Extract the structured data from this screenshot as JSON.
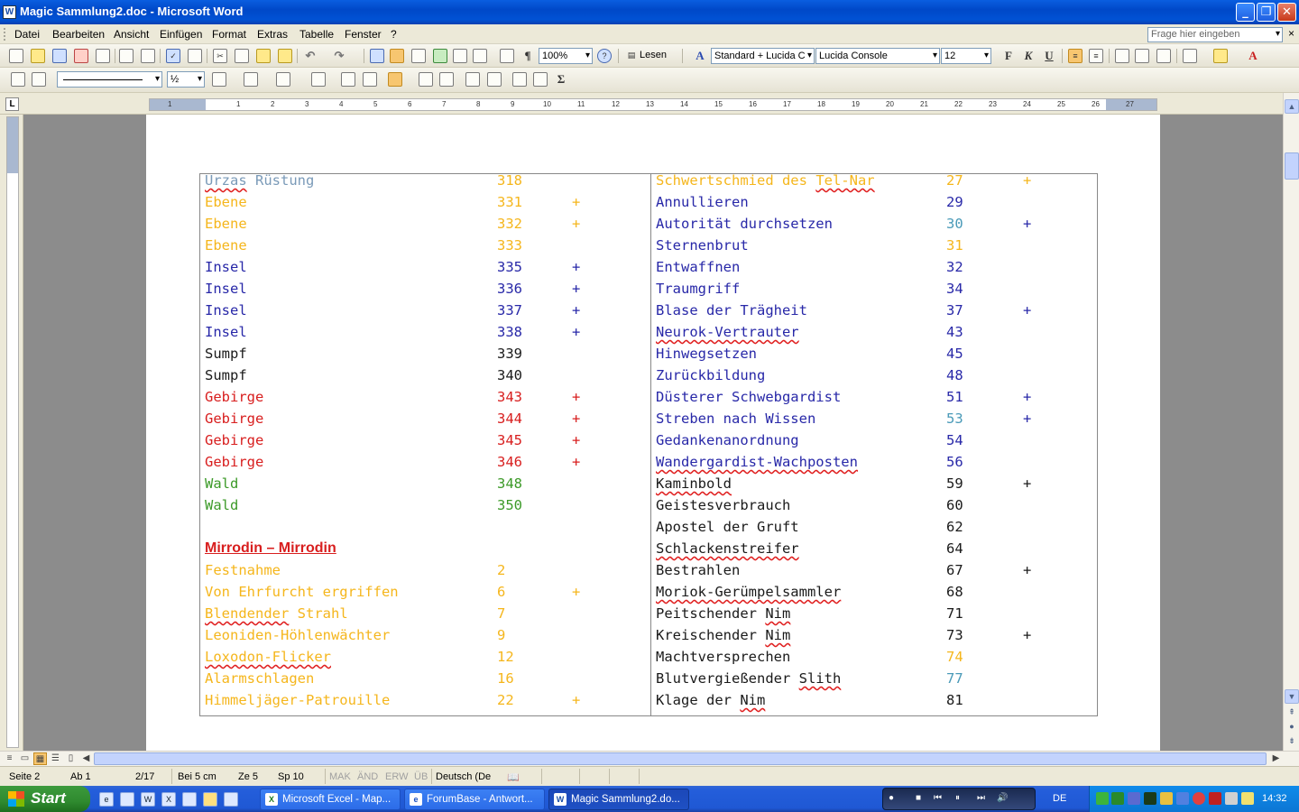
{
  "window": {
    "title": "Magic Sammlung2.doc - Microsoft Word",
    "app_icon": "W",
    "minimize": "_",
    "restore": "❐",
    "close": "✕"
  },
  "menu": {
    "items": [
      "Datei",
      "Bearbeiten",
      "Ansicht",
      "Einfügen",
      "Format",
      "Extras",
      "Tabelle",
      "Fenster",
      "?"
    ],
    "ask_placeholder": "Frage hier eingeben"
  },
  "toolbar": {
    "zoom": "100%",
    "read_button": "Lesen",
    "style": "Standard + Lucida C",
    "font": "Lucida Console",
    "size": "12",
    "bold": "F",
    "italic": "K",
    "underline": "U",
    "line_weight": "½",
    "paragraph_mark": "¶",
    "sum": "Σ"
  },
  "ruler": {
    "corner": "L",
    "numbers": [
      "1",
      "1",
      "2",
      "3",
      "4",
      "5",
      "6",
      "7",
      "8",
      "9",
      "10",
      "11",
      "12",
      "13",
      "14",
      "15",
      "16",
      "17",
      "18",
      "19",
      "20",
      "21",
      "22",
      "23",
      "24",
      "25",
      "26",
      "27"
    ]
  },
  "colors": {
    "yellow": "#f5b61c",
    "blue": "#2828a8",
    "black": "#1a1a1a",
    "red": "#d81e1e",
    "green": "#3c9a28",
    "grayblue": "#7a9ab8",
    "teal": "#4a9ab8"
  },
  "document": {
    "left_rows": [
      {
        "name": "Urzas Rüstung",
        "num": "318",
        "mark": "",
        "color": "grayblue",
        "spell": "Urzas",
        "num_color": "yellow"
      },
      {
        "name": "Ebene",
        "num": "331",
        "mark": "+",
        "color": "yellow"
      },
      {
        "name": "Ebene",
        "num": "332",
        "mark": "+",
        "color": "yellow"
      },
      {
        "name": "Ebene",
        "num": "333",
        "mark": "",
        "color": "yellow"
      },
      {
        "name": "Insel",
        "num": "335",
        "mark": "+",
        "color": "blue"
      },
      {
        "name": "Insel",
        "num": "336",
        "mark": "+",
        "color": "blue"
      },
      {
        "name": "Insel",
        "num": "337",
        "mark": "+",
        "color": "blue"
      },
      {
        "name": "Insel",
        "num": "338",
        "mark": "+",
        "color": "blue"
      },
      {
        "name": "Sumpf",
        "num": "339",
        "mark": "",
        "color": "black"
      },
      {
        "name": "Sumpf",
        "num": "340",
        "mark": "",
        "color": "black"
      },
      {
        "name": "Gebirge",
        "num": "343",
        "mark": "+",
        "color": "red"
      },
      {
        "name": "Gebirge",
        "num": "344",
        "mark": "+",
        "color": "red"
      },
      {
        "name": "Gebirge",
        "num": "345",
        "mark": "+",
        "color": "red"
      },
      {
        "name": "Gebirge",
        "num": "346",
        "mark": "+",
        "color": "red"
      },
      {
        "name": "Wald",
        "num": "348",
        "mark": "",
        "color": "green"
      },
      {
        "name": "Wald",
        "num": "350",
        "mark": "",
        "color": "green"
      },
      {
        "name": "",
        "num": "",
        "mark": "",
        "color": "black"
      },
      {
        "name": "Mirrodin – Mirrodin",
        "num": "",
        "mark": "",
        "color": "red",
        "heading": true
      },
      {
        "name": "Festnahme",
        "num": "2",
        "mark": "",
        "color": "yellow"
      },
      {
        "name": "Von Ehrfurcht ergriffen",
        "num": "6",
        "mark": "+",
        "color": "yellow"
      },
      {
        "name": "Blendender Strahl",
        "num": "7",
        "mark": "",
        "color": "yellow",
        "spell": "Blendender"
      },
      {
        "name": "Leoniden-Höhlenwächter",
        "num": "9",
        "mark": "",
        "color": "yellow"
      },
      {
        "name": "Loxodon-Flicker",
        "num": "12",
        "mark": "",
        "color": "yellow",
        "spell": "Loxodon-Flicker"
      },
      {
        "name": "Alarmschlagen",
        "num": "16",
        "mark": "",
        "color": "yellow"
      },
      {
        "name": "Himmeljäger-Patrouille",
        "num": "22",
        "mark": "+",
        "color": "yellow"
      }
    ],
    "right_rows": [
      {
        "name": "Schwertschmied des Tel-Nar",
        "num": "27",
        "mark": "+",
        "color": "yellow",
        "spell": "Tel-Nar"
      },
      {
        "name": "Annullieren",
        "num": "29",
        "mark": "",
        "color": "blue"
      },
      {
        "name": "Autorität durchsetzen",
        "num": "30",
        "mark": "+",
        "color": "blue",
        "num_color": "teal"
      },
      {
        "name": "Sternenbrut",
        "num": "31",
        "mark": "",
        "color": "blue",
        "num_color": "yellow"
      },
      {
        "name": "Entwaffnen",
        "num": "32",
        "mark": "",
        "color": "blue"
      },
      {
        "name": "Traumgriff",
        "num": "34",
        "mark": "",
        "color": "blue"
      },
      {
        "name": "Blase der Trägheit",
        "num": "37",
        "mark": "+",
        "color": "blue"
      },
      {
        "name": "Neurok-Vertrauter",
        "num": "43",
        "mark": "",
        "color": "blue",
        "spell": "Neurok-Vertrauter"
      },
      {
        "name": "Hinwegsetzen",
        "num": "45",
        "mark": "",
        "color": "blue"
      },
      {
        "name": "Zurückbildung",
        "num": "48",
        "mark": "",
        "color": "blue"
      },
      {
        "name": "Düsterer Schwebgardist",
        "num": "51",
        "mark": "+",
        "color": "blue"
      },
      {
        "name": "Streben nach Wissen",
        "num": "53",
        "mark": "+",
        "color": "blue",
        "num_color": "teal"
      },
      {
        "name": "Gedankenanordnung",
        "num": "54",
        "mark": "",
        "color": "blue"
      },
      {
        "name": "Wandergardist-Wachposten",
        "num": "56",
        "mark": "",
        "color": "blue",
        "spell": "Wandergardist-Wachposten"
      },
      {
        "name": "Kaminbold",
        "num": "59",
        "mark": "+",
        "color": "black",
        "spell": "Kaminbold"
      },
      {
        "name": "Geistesverbrauch",
        "num": "60",
        "mark": "",
        "color": "black"
      },
      {
        "name": "Apostel der Gruft",
        "num": "62",
        "mark": "",
        "color": "black"
      },
      {
        "name": "Schlackenstreifer",
        "num": "64",
        "mark": "",
        "color": "black",
        "spell": "Schlackenstreifer"
      },
      {
        "name": "Bestrahlen",
        "num": "67",
        "mark": "+",
        "color": "black"
      },
      {
        "name": "Moriok-Gerümpelsammler",
        "num": "68",
        "mark": "",
        "color": "black",
        "spell": "Moriok-Gerümpelsammler"
      },
      {
        "name": "Peitschender Nim",
        "num": "71",
        "mark": "",
        "color": "black",
        "spell": "Nim"
      },
      {
        "name": "Kreischender Nim",
        "num": "73",
        "mark": "+",
        "color": "black",
        "spell": "Nim"
      },
      {
        "name": "Machtversprechen",
        "num": "74",
        "mark": "",
        "color": "black",
        "num_color": "yellow"
      },
      {
        "name": "Blutvergießender Slith",
        "num": "77",
        "mark": "",
        "color": "black",
        "spell": "Slith",
        "num_color": "teal"
      },
      {
        "name": "Klage der Nim",
        "num": "81",
        "mark": "",
        "color": "black",
        "spell": "Nim"
      }
    ]
  },
  "status": {
    "page": "Seite 2",
    "section": "Ab 1",
    "pages": "2/17",
    "at": "Bei 5 cm",
    "line": "Ze 5",
    "col": "Sp 10",
    "rec": "MAK",
    "trk": "ÄND",
    "ext": "ERW",
    "ovr": "ÜB",
    "language": "Deutsch (De"
  },
  "taskbar": {
    "start": "Start",
    "tasks": [
      {
        "label": "Microsoft Excel - Map...",
        "icon": "X"
      },
      {
        "label": "ForumBase - Antwort...",
        "icon": "e"
      },
      {
        "label": "Magic Sammlung2.do...",
        "icon": "W"
      }
    ],
    "lang": "DE",
    "clock": "14:32"
  }
}
